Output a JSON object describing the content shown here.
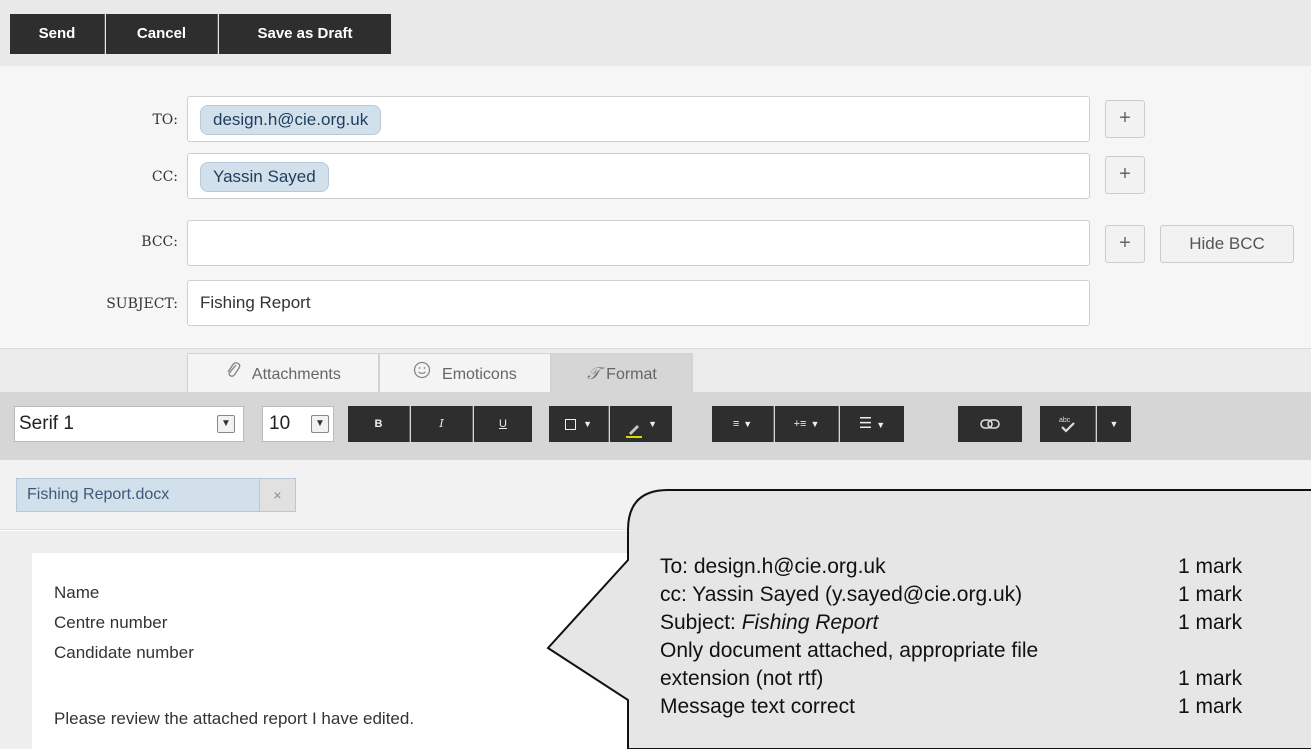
{
  "toolbar": {
    "send_label": "Send",
    "cancel_label": "Cancel",
    "draft_label": "Save as Draft"
  },
  "headers": {
    "to_label": "TO:",
    "to_chip": "design.h@cie.org.uk",
    "cc_label": "CC:",
    "cc_chip": "Yassin Sayed",
    "bcc_label": "BCC:",
    "bcc_value": "",
    "subject_label": "SUBJECT:",
    "subject_value": "Fishing Report",
    "plus_label": "+",
    "hide_bcc_label": "Hide BCC"
  },
  "tabs": [
    {
      "label": "Attachments",
      "icon": "paperclip-icon"
    },
    {
      "label": "Emoticons",
      "icon": "smiley-icon"
    },
    {
      "label": "Format",
      "icon": "format-icon"
    }
  ],
  "format": {
    "font": "Serif 1",
    "size": "10",
    "bold": "B",
    "italic": "I",
    "underline": "U"
  },
  "attachment": {
    "filename": "Fishing Report.docx",
    "remove": "×"
  },
  "message": {
    "lines": [
      "Name",
      "Centre number",
      "Candidate number",
      "Please review the attached report I have edited."
    ]
  },
  "callout": {
    "rows": [
      {
        "text": "To: design.h@cie.org.uk",
        "mark": "1 mark"
      },
      {
        "text_prefix": "cc: Yassin Sayed (y.sayed@cie.org.uk)",
        "mark": "1 mark"
      },
      {
        "text_prefix": "Subject: ",
        "text_italic": "Fishing Report",
        "mark": "1 mark"
      },
      {
        "text": "Only document attached, appropriate file"
      },
      {
        "text": "extension (not rtf)",
        "mark": "1 mark"
      },
      {
        "text": "Message text correct",
        "mark": "1 mark"
      }
    ]
  }
}
